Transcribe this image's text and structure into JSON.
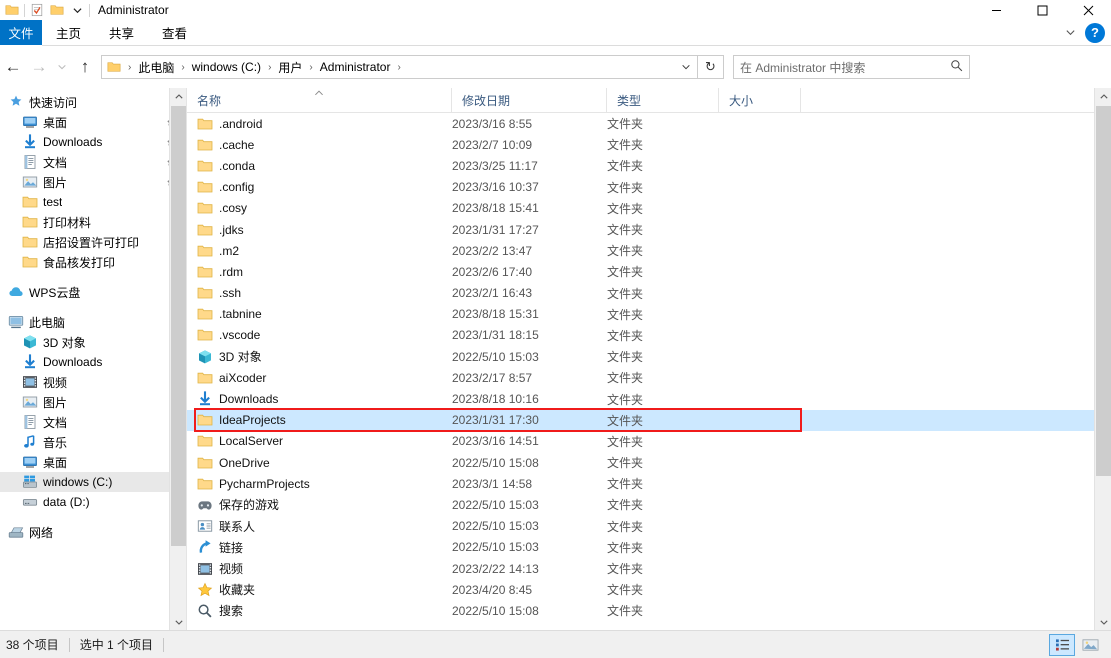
{
  "window": {
    "title": "Administrator",
    "quick_access": [
      "folder-icon",
      "properties-icon",
      "new-folder-icon",
      "customize-chevron-icon"
    ],
    "controls": {
      "minimize": "—",
      "maximize": "□",
      "close": "✕"
    }
  },
  "ribbon": {
    "file_tab": "文件",
    "tabs": [
      "主页",
      "共享",
      "查看"
    ],
    "collapse_icon": "chevron-down-icon",
    "help_label": "?"
  },
  "addressbar": {
    "back_icon": "←",
    "forward_icon": "→",
    "recent_icon": "⌄",
    "up_icon": "↑",
    "breadcrumbs": [
      "此电脑",
      "windows (C:)",
      "用户",
      "Administrator"
    ],
    "separator": "›",
    "dropdown_icon": "⌄",
    "refresh_icon": "↻",
    "search_placeholder": "在 Administrator 中搜索",
    "search_value": "",
    "search_icon": "⚲"
  },
  "sidebar": {
    "groups": [
      {
        "header": {
          "label": "快速访问",
          "icon": "star-pin-icon"
        },
        "items": [
          {
            "label": "桌面",
            "icon": "desktop-icon",
            "pinned": true,
            "indent": true
          },
          {
            "label": "Downloads",
            "icon": "downloads-icon",
            "pinned": true,
            "indent": true
          },
          {
            "label": "文档",
            "icon": "documents-icon",
            "pinned": true,
            "indent": true
          },
          {
            "label": "图片",
            "icon": "pictures-icon",
            "pinned": true,
            "indent": true
          },
          {
            "label": "test",
            "icon": "folder-icon",
            "pinned": false,
            "indent": true
          },
          {
            "label": "打印材料",
            "icon": "folder-icon",
            "pinned": false,
            "indent": true
          },
          {
            "label": "店招设置许可打印",
            "icon": "folder-icon",
            "pinned": false,
            "indent": true
          },
          {
            "label": "食品核发打印",
            "icon": "folder-icon",
            "pinned": false,
            "indent": true
          }
        ]
      },
      {
        "header": {
          "label": "WPS云盘",
          "icon": "cloud-icon"
        },
        "items": []
      },
      {
        "header": {
          "label": "此电脑",
          "icon": "this-pc-icon"
        },
        "items": [
          {
            "label": "3D 对象",
            "icon": "3d-objects-icon",
            "pinned": false,
            "indent": true
          },
          {
            "label": "Downloads",
            "icon": "downloads-icon",
            "pinned": false,
            "indent": true
          },
          {
            "label": "视频",
            "icon": "videos-icon",
            "pinned": false,
            "indent": true
          },
          {
            "label": "图片",
            "icon": "pictures-icon",
            "pinned": false,
            "indent": true
          },
          {
            "label": "文档",
            "icon": "documents-icon",
            "pinned": false,
            "indent": true
          },
          {
            "label": "音乐",
            "icon": "music-icon",
            "pinned": false,
            "indent": true
          },
          {
            "label": "桌面",
            "icon": "desktop-icon",
            "pinned": false,
            "indent": true
          },
          {
            "label": "windows (C:)",
            "icon": "windows-drive-icon",
            "pinned": false,
            "indent": true,
            "selected": true
          },
          {
            "label": "data (D:)",
            "icon": "drive-icon",
            "pinned": false,
            "indent": true
          }
        ]
      },
      {
        "header": {
          "label": "网络",
          "icon": "network-icon"
        },
        "items": []
      }
    ]
  },
  "filelist": {
    "columns": [
      {
        "label": "名称",
        "sorted": true,
        "sort_dir": "asc"
      },
      {
        "label": "修改日期",
        "sorted": false
      },
      {
        "label": "类型",
        "sorted": false
      },
      {
        "label": "大小",
        "sorted": false
      }
    ],
    "sort_caret": "⌃",
    "rows": [
      {
        "name": ".android",
        "date": "2023/3/16 8:55",
        "type": "文件夹",
        "size": "",
        "icon": "folder-icon"
      },
      {
        "name": ".cache",
        "date": "2023/2/7 10:09",
        "type": "文件夹",
        "size": "",
        "icon": "folder-icon"
      },
      {
        "name": ".conda",
        "date": "2023/3/25 11:17",
        "type": "文件夹",
        "size": "",
        "icon": "folder-icon"
      },
      {
        "name": ".config",
        "date": "2023/3/16 10:37",
        "type": "文件夹",
        "size": "",
        "icon": "folder-icon"
      },
      {
        "name": ".cosy",
        "date": "2023/8/18 15:41",
        "type": "文件夹",
        "size": "",
        "icon": "folder-icon"
      },
      {
        "name": ".jdks",
        "date": "2023/1/31 17:27",
        "type": "文件夹",
        "size": "",
        "icon": "folder-icon"
      },
      {
        "name": ".m2",
        "date": "2023/2/2 13:47",
        "type": "文件夹",
        "size": "",
        "icon": "folder-icon"
      },
      {
        "name": ".rdm",
        "date": "2023/2/6 17:40",
        "type": "文件夹",
        "size": "",
        "icon": "folder-icon"
      },
      {
        "name": ".ssh",
        "date": "2023/2/1 16:43",
        "type": "文件夹",
        "size": "",
        "icon": "folder-icon"
      },
      {
        "name": ".tabnine",
        "date": "2023/8/18 15:31",
        "type": "文件夹",
        "size": "",
        "icon": "folder-icon"
      },
      {
        "name": ".vscode",
        "date": "2023/1/31 18:15",
        "type": "文件夹",
        "size": "",
        "icon": "folder-icon"
      },
      {
        "name": "3D 对象",
        "date": "2022/5/10 15:03",
        "type": "文件夹",
        "size": "",
        "icon": "3d-objects-icon"
      },
      {
        "name": "aiXcoder",
        "date": "2023/2/17 8:57",
        "type": "文件夹",
        "size": "",
        "icon": "folder-icon"
      },
      {
        "name": "Downloads",
        "date": "2023/8/18 10:16",
        "type": "文件夹",
        "size": "",
        "icon": "downloads-icon"
      },
      {
        "name": "IdeaProjects",
        "date": "2023/1/31 17:30",
        "type": "文件夹",
        "size": "",
        "icon": "folder-icon",
        "selected": true,
        "highlighted": true
      },
      {
        "name": "LocalServer",
        "date": "2023/3/16 14:51",
        "type": "文件夹",
        "size": "",
        "icon": "folder-icon"
      },
      {
        "name": "OneDrive",
        "date": "2022/5/10 15:08",
        "type": "文件夹",
        "size": "",
        "icon": "folder-icon"
      },
      {
        "name": "PycharmProjects",
        "date": "2023/3/1 14:58",
        "type": "文件夹",
        "size": "",
        "icon": "folder-icon"
      },
      {
        "name": "保存的游戏",
        "date": "2022/5/10 15:03",
        "type": "文件夹",
        "size": "",
        "icon": "saved-games-icon"
      },
      {
        "name": "联系人",
        "date": "2022/5/10 15:03",
        "type": "文件夹",
        "size": "",
        "icon": "contacts-icon"
      },
      {
        "name": "链接",
        "date": "2022/5/10 15:03",
        "type": "文件夹",
        "size": "",
        "icon": "links-icon"
      },
      {
        "name": "视频",
        "date": "2023/2/22 14:13",
        "type": "文件夹",
        "size": "",
        "icon": "videos-icon"
      },
      {
        "name": "收藏夹",
        "date": "2023/4/20 8:45",
        "type": "文件夹",
        "size": "",
        "icon": "favorites-icon"
      },
      {
        "name": "搜索",
        "date": "2022/5/10 15:08",
        "type": "文件夹",
        "size": "",
        "icon": "search-folder-icon"
      }
    ]
  },
  "statusbar": {
    "item_count": "38 个项目",
    "selection": "选中 1 个项目",
    "view_details": "details-view-icon",
    "view_large": "large-icons-view-icon"
  },
  "colors": {
    "accent": "#0072c6",
    "selection": "#cce8ff",
    "annotation": "#f01b1b",
    "folder": "#ffd16b"
  }
}
